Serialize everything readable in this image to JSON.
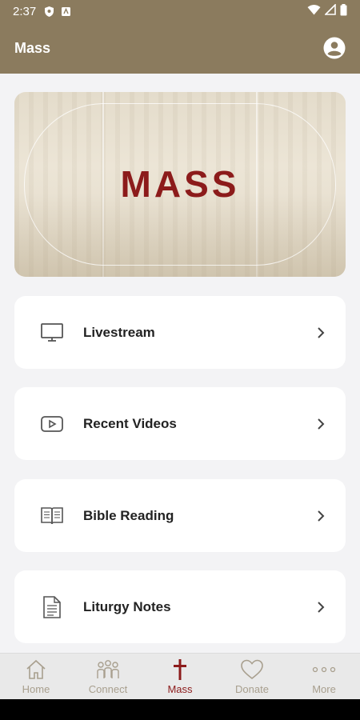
{
  "status_bar": {
    "time": "2:37"
  },
  "app_bar": {
    "title": "Mass"
  },
  "hero": {
    "title": "MASS"
  },
  "menu": [
    {
      "label": "Livestream",
      "icon": "monitor-icon"
    },
    {
      "label": "Recent Videos",
      "icon": "video-play-icon"
    },
    {
      "label": "Bible Reading",
      "icon": "open-book-icon"
    },
    {
      "label": "Liturgy Notes",
      "icon": "document-icon"
    }
  ],
  "bottom_nav": [
    {
      "label": "Home",
      "icon": "home-icon",
      "active": false
    },
    {
      "label": "Connect",
      "icon": "people-icon",
      "active": false
    },
    {
      "label": "Mass",
      "icon": "cross-icon",
      "active": true
    },
    {
      "label": "Donate",
      "icon": "heart-icon",
      "active": false
    },
    {
      "label": "More",
      "icon": "more-dots-icon",
      "active": false
    }
  ],
  "colors": {
    "header": "#8b7b5e",
    "accent": "#8c1b1b",
    "nav_inactive": "#a89f8e"
  }
}
